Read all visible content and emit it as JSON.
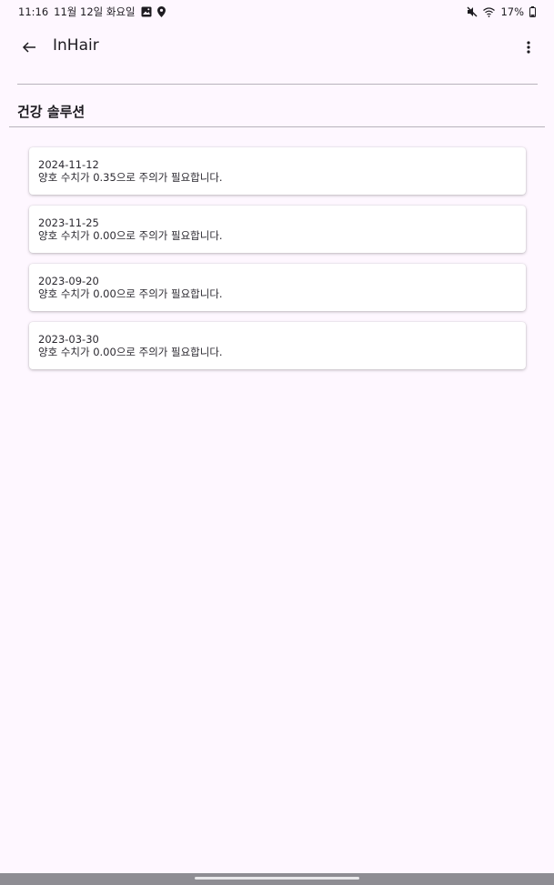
{
  "status_bar": {
    "time": "11:16",
    "date": "11월 12일 화요일",
    "battery": "17%",
    "icons": [
      "gallery-icon",
      "location-icon",
      "mute-icon",
      "wifi-icon",
      "battery-icon"
    ]
  },
  "app_bar": {
    "title": "InHair",
    "back_icon": "arrow-left-icon",
    "more_icon": "more-vert-icon"
  },
  "section": {
    "title": "건강 솔루션"
  },
  "records": [
    {
      "date": "2024-11-12",
      "message": "양호 수치가 0.35으로 주의가 필요합니다."
    },
    {
      "date": "2023-11-25",
      "message": "양호 수치가 0.00으로 주의가 필요합니다."
    },
    {
      "date": "2023-09-20",
      "message": "양호 수치가 0.00으로 주의가 필요합니다."
    },
    {
      "date": "2023-03-30",
      "message": "양호 수치가 0.00으로 주의가 필요합니다."
    }
  ],
  "colors": {
    "background": "#fef7ff",
    "card": "#ffffff",
    "divider": "#b8b3bc",
    "nav_bar": "#8e8d93"
  }
}
